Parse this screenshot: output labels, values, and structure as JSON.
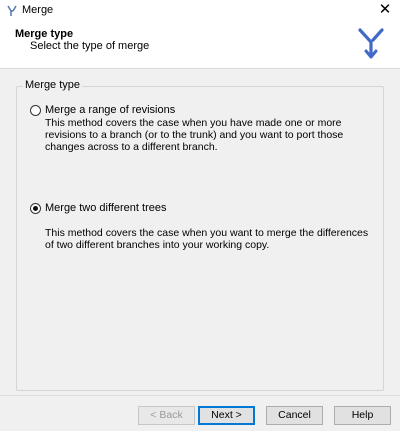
{
  "window": {
    "title": "Merge",
    "close_glyph": "✕"
  },
  "header": {
    "title": "Merge type",
    "subtitle": "Select the type of merge",
    "logo_icon": "merge-branch-logo",
    "logo_color": "#4169c8"
  },
  "group": {
    "label": "Merge type",
    "options": [
      {
        "label": "Merge a range of revisions",
        "selected": false,
        "description": "This method covers the case when you have made one or more revisions to a branch (or to the trunk) and you want to port those changes across to a different branch."
      },
      {
        "label": "Merge two different trees",
        "selected": true,
        "description": "This method covers the case when you want to merge the differences of two different branches into your working copy."
      }
    ]
  },
  "buttons": {
    "back": "< Back",
    "next": "Next >",
    "cancel": "Cancel",
    "help": "Help"
  }
}
